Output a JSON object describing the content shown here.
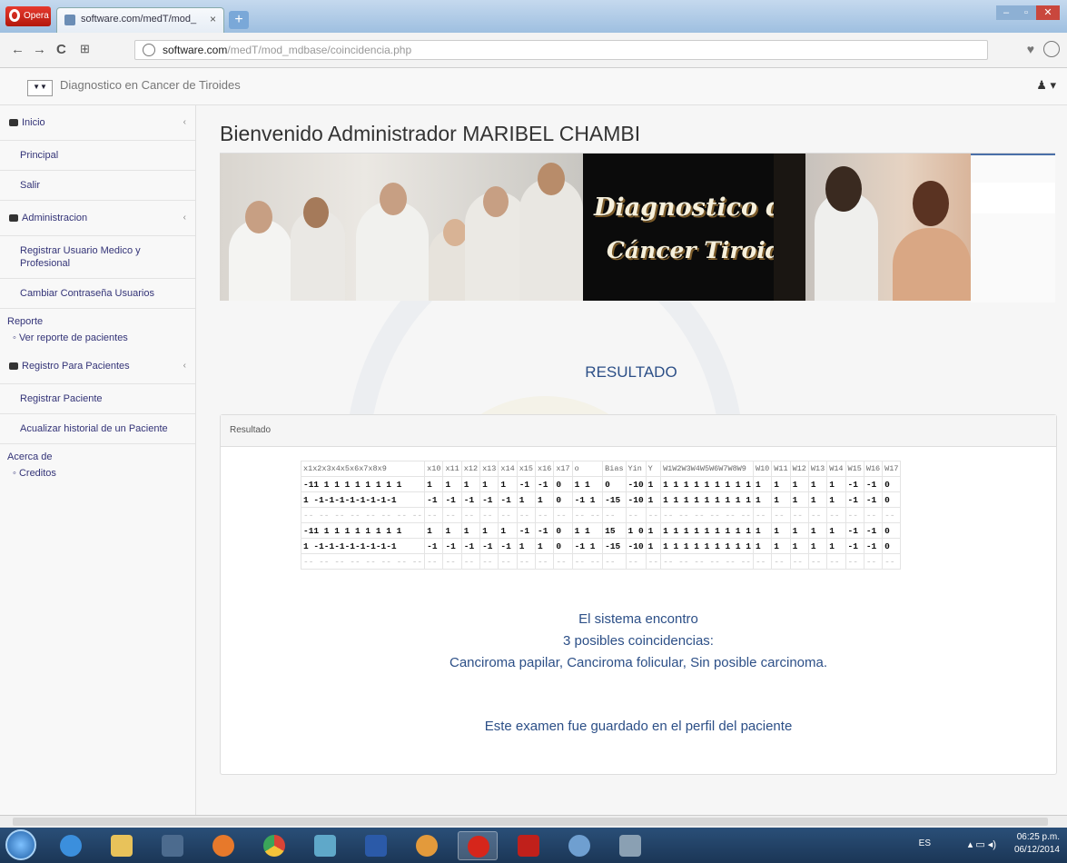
{
  "browser": {
    "opera_label": "Opera",
    "tab_title": "software.com/medT/mod_",
    "tab_close": "×",
    "new_tab": "+",
    "url_host": "software.com",
    "url_path": "/medT/mod_mdbase/coincidencia.php",
    "back": "←",
    "forward": "→",
    "reload": "C",
    "heart": "♥"
  },
  "navbar": {
    "logo_text": "▼▼",
    "brand": "Diagnostico en Cancer de Tiroides",
    "user_menu": "♟ ▾"
  },
  "sidebar": {
    "inicio": {
      "label": "Inicio",
      "caret": "‹",
      "items": [
        "Principal",
        "Salir"
      ]
    },
    "administracion": {
      "label": "Administracion",
      "caret": "‹",
      "items": [
        "Registrar Usuario Medico y Profesional",
        "Cambiar Contraseña Usuarios"
      ]
    },
    "reporte": {
      "label": "Reporte",
      "sub": "◦ Ver reporte de pacientes"
    },
    "registro": {
      "label": "Registro Para Pacientes",
      "caret": "‹",
      "items": [
        "Registrar Paciente",
        "Acualizar historial de un Paciente"
      ]
    },
    "acerca": {
      "label": "Acerca de",
      "sub": "◦ Creditos"
    }
  },
  "main": {
    "welcome": "Bienvenido Administrador MARIBEL CHAMBI",
    "banner_line1": "Diagnostico de",
    "banner_line2": "Cáncer Tiroideo",
    "resultado_heading": "RESULTADO",
    "panel_title": "Resultado",
    "message_line1": "El sistema encontro",
    "message_line2": "3 posibles coincidencias:",
    "message_line3": "Canciroma papilar, Canciroma folicular, Sin posible carcinoma.",
    "saved_message": "Este examen fue guardado en el perfil del paciente"
  },
  "matrix": {
    "headers": [
      "x1x2x3x4x5x6x7x8x9",
      "x10",
      "x11",
      "x12",
      "x13",
      "x14",
      "x15",
      "x16",
      "x17",
      "o",
      "Bias",
      "Yin",
      "Y",
      "W1W2W3W4W5W6W7W8W9",
      "W10",
      "W11",
      "W12",
      "W13",
      "W14",
      "W15",
      "W16",
      "W17"
    ],
    "rows": [
      [
        "-11 1 1 1 1 1 1 1 1",
        "1",
        "1",
        "1",
        "1",
        "1",
        "-1",
        "-1",
        "0",
        "1 1",
        "0",
        "-10",
        "1",
        "1 1 1 1 1 1 1 1 1",
        "1",
        "1",
        "1",
        "1",
        "1",
        "-1",
        "-1",
        "0"
      ],
      [
        "1 -1-1-1-1-1-1-1-1",
        "-1",
        "-1",
        "-1",
        "-1",
        "-1",
        "1",
        "1",
        "0",
        "-1 1",
        "-15",
        "-10",
        "1",
        "1 1 1 1 1 1 1 1 1",
        "1",
        "1",
        "1",
        "1",
        "1",
        "-1",
        "-1",
        "0"
      ],
      [
        "-- -- -- -- -- -- -- --",
        "--",
        "--",
        "--",
        "--",
        "--",
        "--",
        "--",
        "--",
        "-- --",
        "--",
        "--",
        "--",
        "-- -- -- -- -- --",
        "--",
        "--",
        "--",
        "--",
        "--",
        "--",
        "--",
        "--"
      ],
      [
        "-11 1 1 1 1 1 1 1 1",
        "1",
        "1",
        "1",
        "1",
        "1",
        "-1",
        "-1",
        "0",
        "1 1",
        "15",
        "1 0",
        "1",
        "1 1 1 1 1 1 1 1 1",
        "1",
        "1",
        "1",
        "1",
        "1",
        "-1",
        "-1",
        "0"
      ],
      [
        "1 -1-1-1-1-1-1-1-1",
        "-1",
        "-1",
        "-1",
        "-1",
        "-1",
        "1",
        "1",
        "0",
        "-1 1",
        "-15",
        "-10",
        "1",
        "1 1 1 1 1 1 1 1 1",
        "1",
        "1",
        "1",
        "1",
        "1",
        "-1",
        "-1",
        "0"
      ],
      [
        "-- -- -- -- -- -- -- --",
        "--",
        "--",
        "--",
        "--",
        "--",
        "--",
        "--",
        "--",
        "-- --",
        "--",
        "--",
        "--",
        "-- -- -- -- -- --",
        "--",
        "--",
        "--",
        "--",
        "--",
        "--",
        "--",
        "--"
      ]
    ]
  },
  "taskbar": {
    "lang": "ES",
    "tray_icons": "▴ ▭ ◂)",
    "time": "06:25 p.m.",
    "date": "06/12/2014"
  },
  "colors": {
    "accent": "#2c4f87",
    "taskbar": "#1b3656"
  }
}
